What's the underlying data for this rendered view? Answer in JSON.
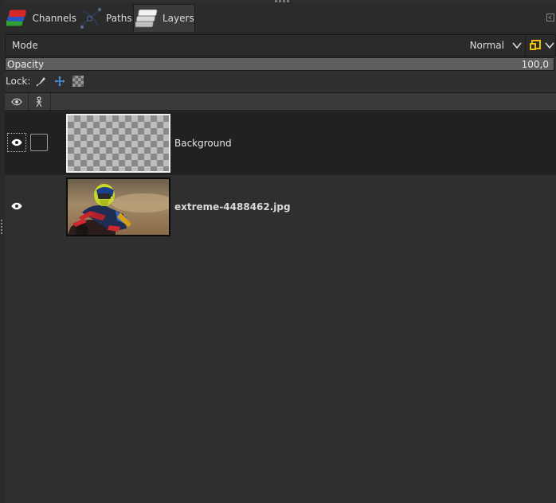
{
  "tabs": [
    {
      "label": "Channels",
      "icon": "channels-icon",
      "active": false
    },
    {
      "label": "Paths",
      "icon": "paths-icon",
      "active": false
    },
    {
      "label": "Layers",
      "icon": "layers-icon",
      "active": true
    }
  ],
  "mode": {
    "label": "Mode",
    "value": "Normal"
  },
  "opacity": {
    "label": "Opacity",
    "value": "100,0",
    "fraction": 1.0
  },
  "lock": {
    "label": "Lock:",
    "buttons": [
      "lock-pixels-icon",
      "lock-position-icon",
      "lock-alpha-icon"
    ]
  },
  "list_header": {
    "columns": [
      "eye-icon",
      "chain-icon"
    ]
  },
  "layers": [
    {
      "name": "Background",
      "visible": true,
      "selected": true,
      "thumbnail": "transparent-checkerboard"
    },
    {
      "name": "extreme-4488462.jpg",
      "visible": true,
      "selected": false,
      "thumbnail": "motocross-rider-photo"
    }
  ],
  "colors": {
    "panel_bg": "#2f2f2f",
    "selected_row": "#212121",
    "accent_yellow": "#f2c200",
    "accent_blue": "#4a8fe0"
  }
}
